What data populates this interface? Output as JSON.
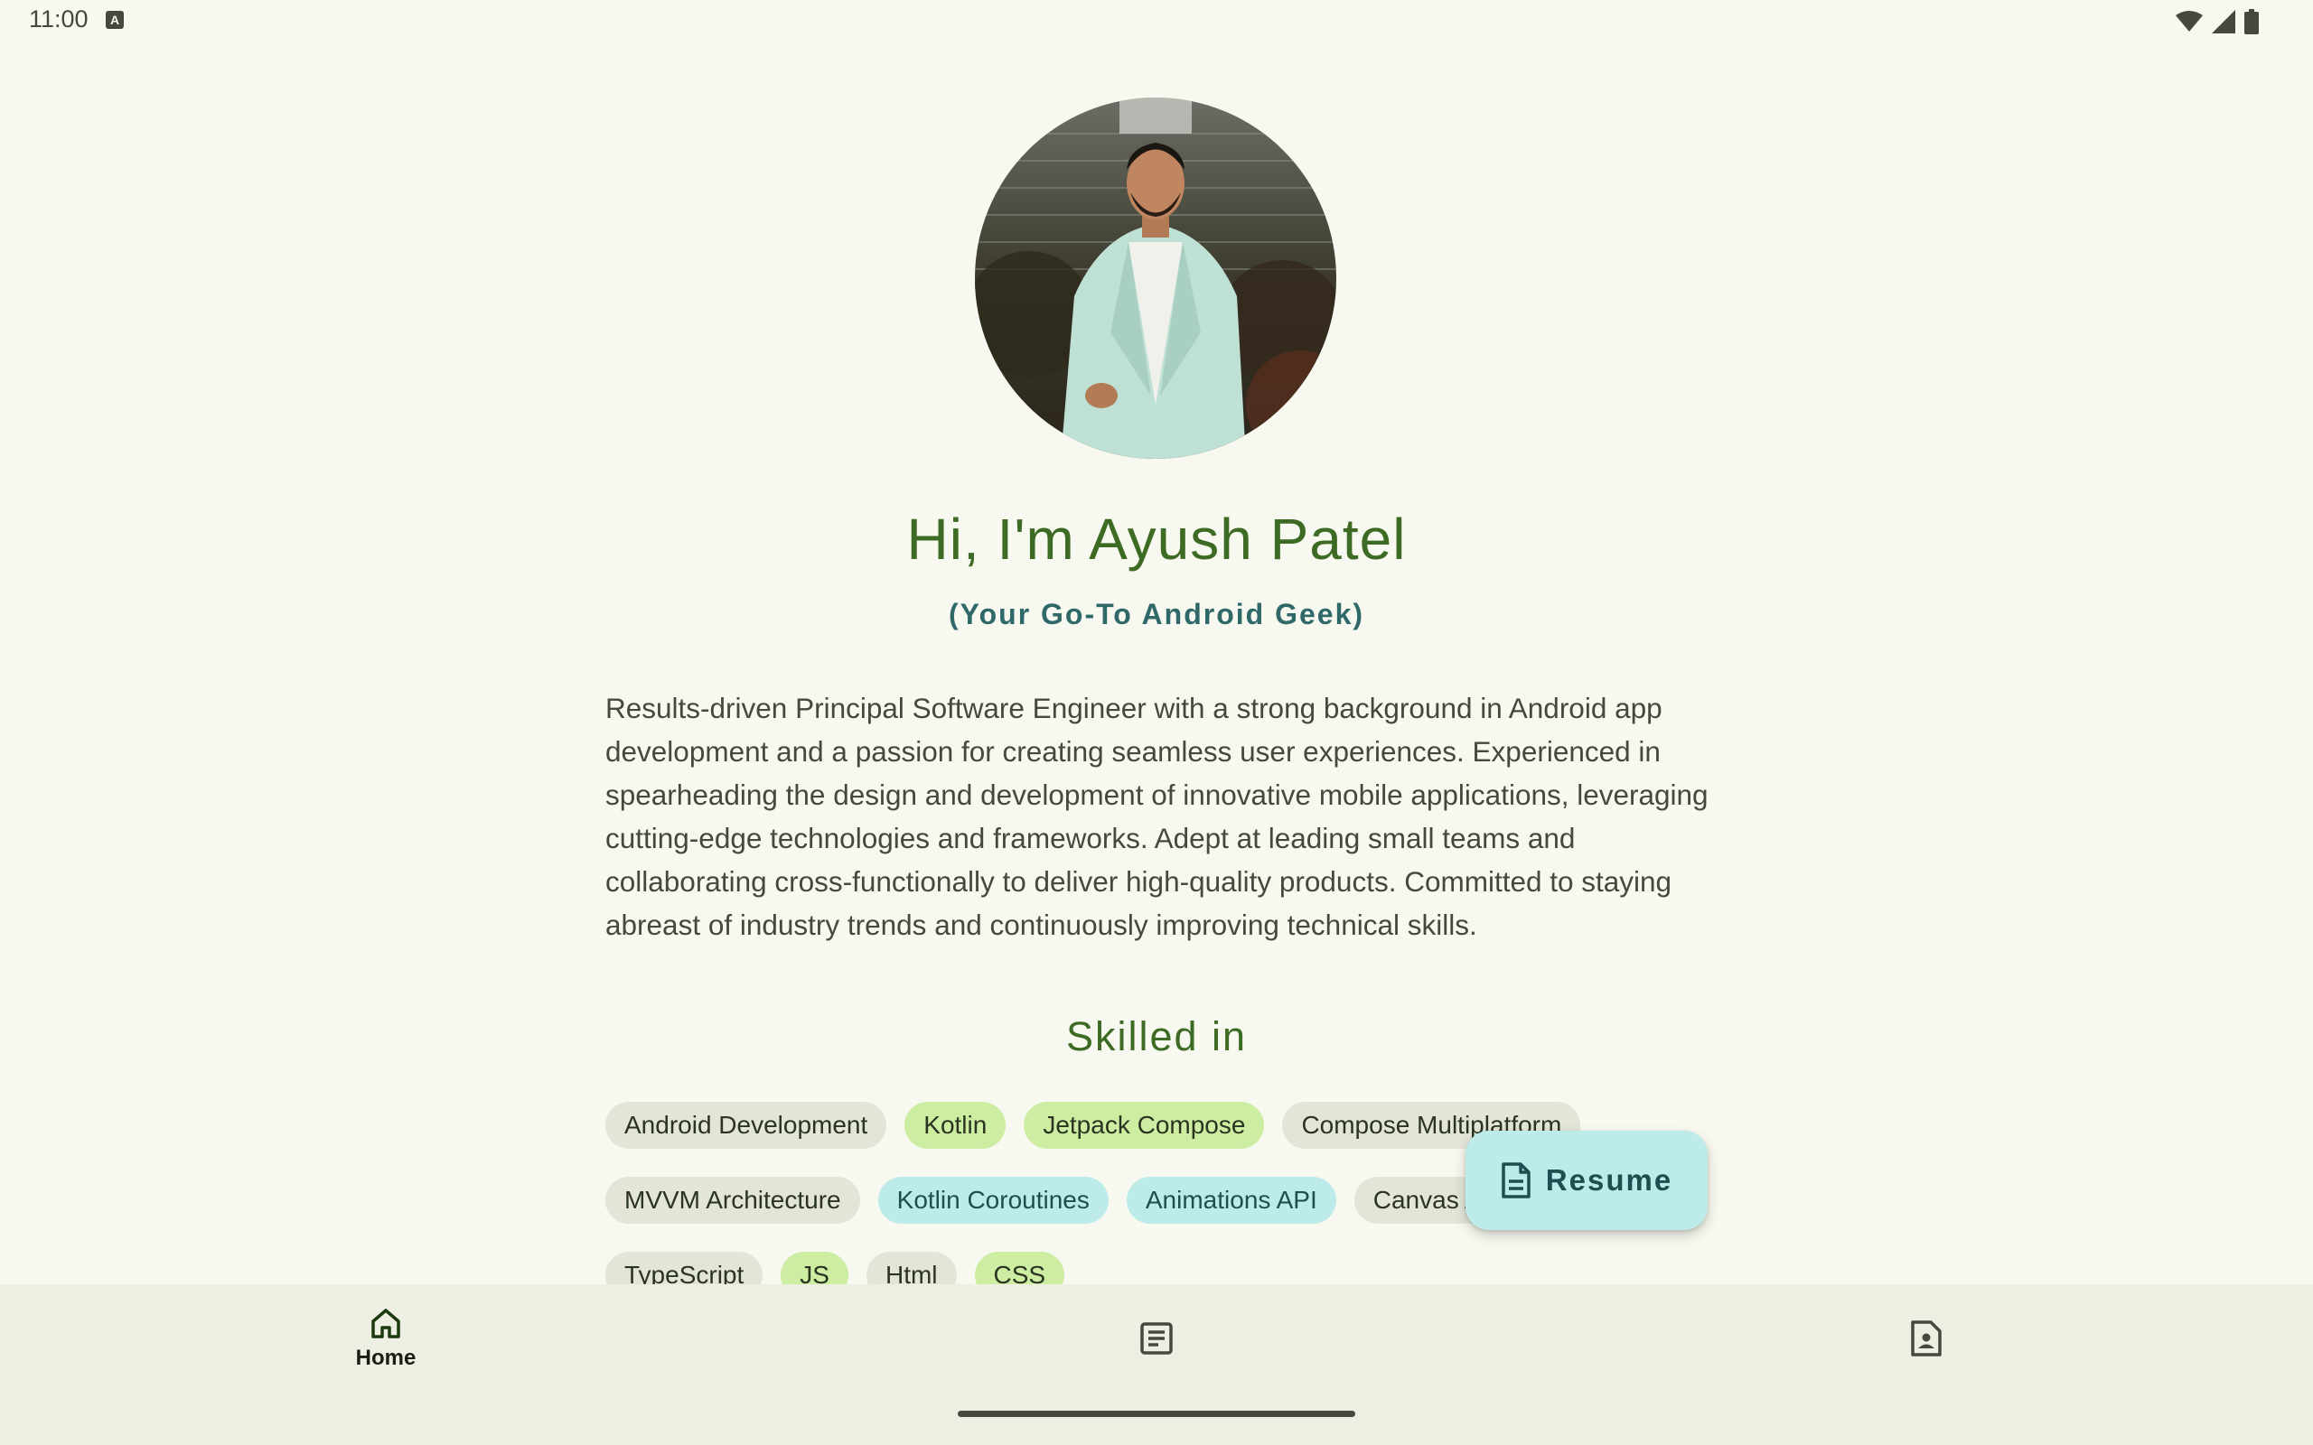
{
  "status_bar": {
    "time": "11:00"
  },
  "profile": {
    "greeting": "Hi, I'm Ayush Patel",
    "tagline": "(Your Go-To Android Geek)",
    "bio": "Results-driven Principal Software Engineer  with a strong background in Android app development and a passion for creating seamless user experiences. Experienced in spearheading the design and development of innovative mobile applications, leveraging cutting-edge technologies and frameworks. Adept at leading small teams and collaborating cross-functionally to deliver high-quality products. Committed to staying abreast of industry trends and continuously improving technical skills."
  },
  "skills": {
    "heading": "Skilled in",
    "rows": [
      [
        "Android Development",
        "Kotlin",
        "Jetpack Compose",
        "Compose Multiplatform"
      ],
      [
        "MVVM Architecture",
        "Kotlin Coroutines",
        "Animations API",
        "Canvas API"
      ],
      [
        "TypeScript",
        "JS",
        "Html",
        "CSS"
      ]
    ]
  },
  "fab": {
    "label": "Resume",
    "icon": "document-icon"
  },
  "bottom_nav": {
    "items": [
      {
        "label": "Home",
        "icon": "home-icon"
      },
      {
        "label": "",
        "icon": "article-icon"
      },
      {
        "label": "",
        "icon": "contact-page-icon"
      }
    ]
  },
  "colors": {
    "background": "#f7f8ef",
    "primary": "#3d6b24",
    "tertiary": "#2f6869",
    "chip_green": "#cdeda3",
    "chip_teal": "#bcebea",
    "chip_neutral": "#e2e5d7",
    "nav_background": "#eeefe3"
  }
}
